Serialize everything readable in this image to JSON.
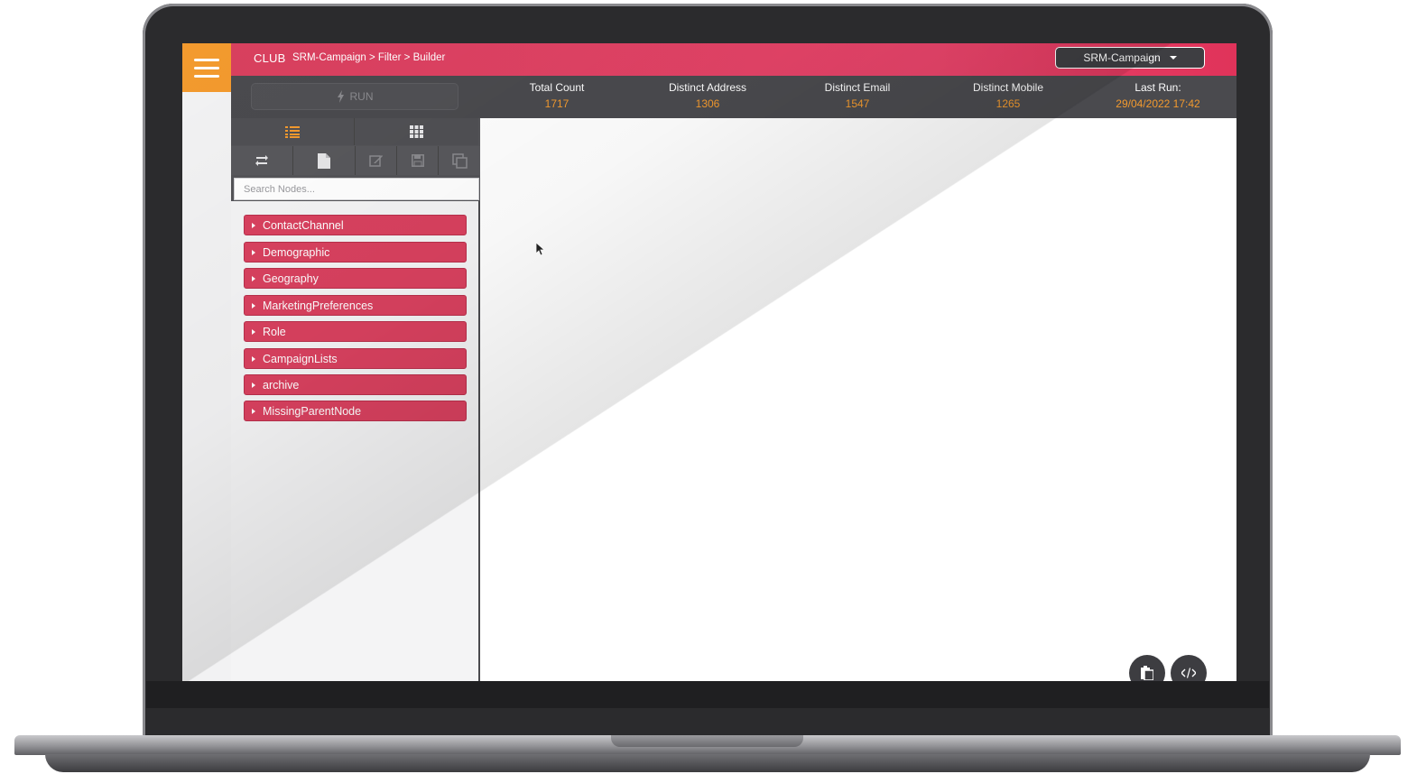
{
  "app": {
    "brand": "CLUB",
    "breadcrumb": "SRM-Campaign > Filter > Builder"
  },
  "campaign_dropdown": {
    "selected": "SRM-Campaign"
  },
  "run_button": {
    "label": "RUN"
  },
  "stats": [
    {
      "label": "Total Count",
      "value": "1717"
    },
    {
      "label": "Distinct Address",
      "value": "1306"
    },
    {
      "label": "Distinct Email",
      "value": "1547"
    },
    {
      "label": "Distinct Mobile",
      "value": "1265"
    },
    {
      "label": "Last Run:",
      "value": "29/04/2022 17:42"
    }
  ],
  "search": {
    "placeholder": "Search Nodes..."
  },
  "nodes": [
    "ContactChannel",
    "Demographic",
    "Geography",
    "MarketingPreferences",
    "Role",
    "CampaignLists",
    "archive",
    "MissingParentNode"
  ],
  "colors": {
    "accent": "#e8446a",
    "menu": "#f39a2e",
    "dark": "#4a4a4e",
    "value": "#f39a2e"
  },
  "icons": [
    "hamburger-icon",
    "lightning-icon",
    "list-icon",
    "grid-icon",
    "refresh-icon",
    "file-icon",
    "edit-icon",
    "save-icon",
    "copy-icon",
    "clipboard-icon",
    "code-icon",
    "cursor-icon"
  ]
}
